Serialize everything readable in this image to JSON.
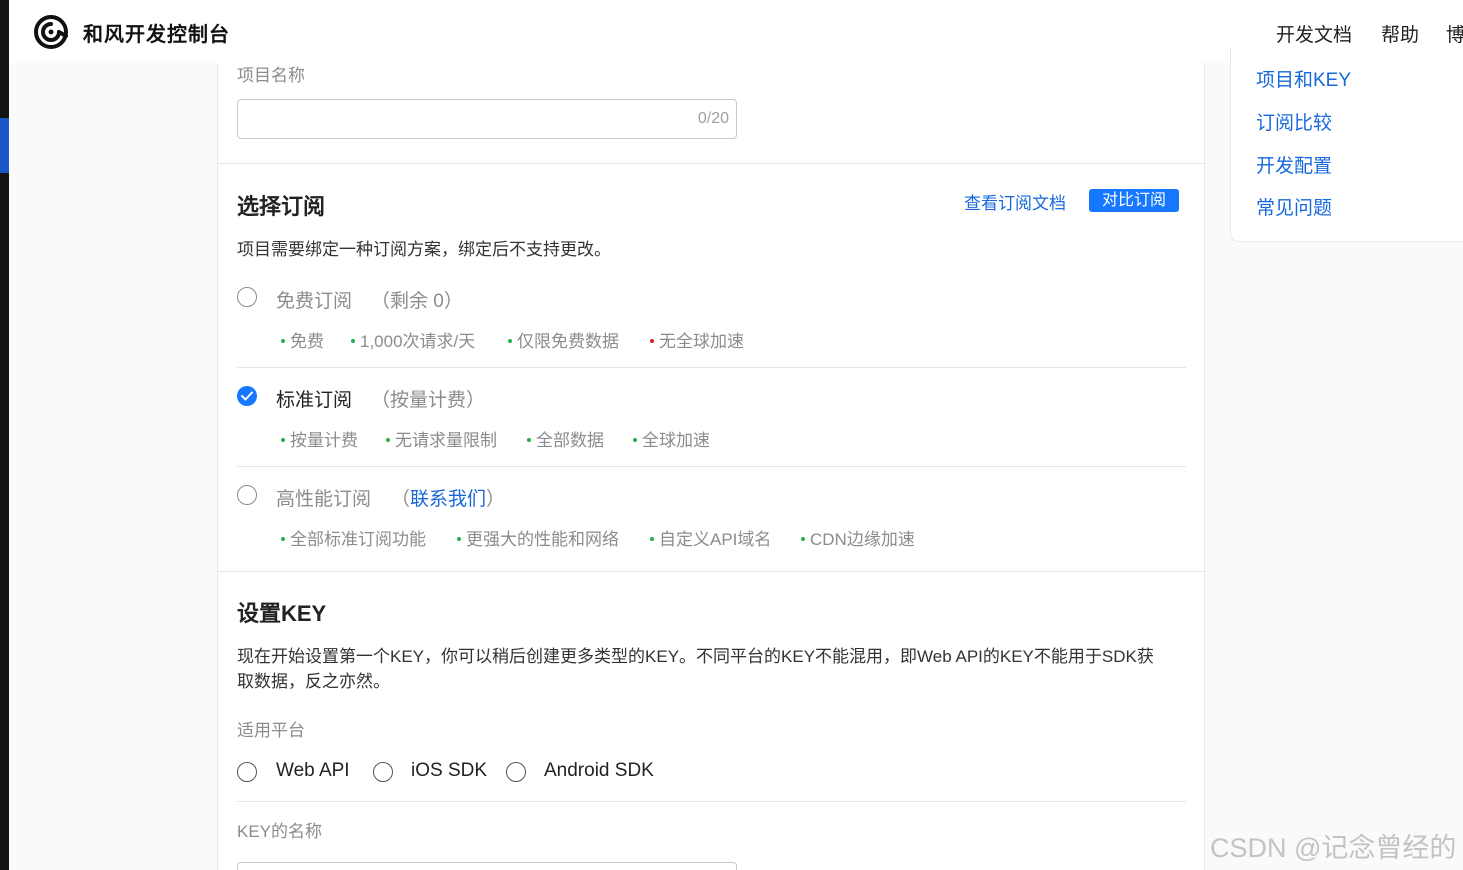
{
  "header": {
    "brand": "和风开发控制台",
    "nav": [
      "开发文档",
      "帮助",
      "博"
    ]
  },
  "toc": {
    "items": [
      "项目和KEY",
      "订阅比较",
      "开发配置",
      "常见问题"
    ]
  },
  "project": {
    "name_label": "项目名称",
    "name_value": "",
    "name_counter": "0/20"
  },
  "subscription": {
    "title": "选择订阅",
    "doc_link": "查看订阅文档",
    "compare_button": "对比订阅",
    "description": "项目需要绑定一种订阅方案，绑定后不支持更改。",
    "options": [
      {
        "name": "免费订阅",
        "tag_open": "（",
        "tag": "剩余 0",
        "tag_close": "）",
        "state": "disabled",
        "features": [
          "免费",
          "1,000次请求/天",
          "仅限免费数据",
          "无全球加速"
        ],
        "feature_dot_colors": [
          "#22b14c",
          "#22b14c",
          "#22b14c",
          "#e02020"
        ]
      },
      {
        "name": "标准订阅",
        "tag_open": "（",
        "tag": "按量计费",
        "tag_close": "）",
        "state": "selected",
        "features": [
          "按量计费",
          "无请求量限制",
          "全部数据",
          "全球加速"
        ],
        "feature_dot_colors": [
          "#22b14c",
          "#22b14c",
          "#22b14c",
          "#22b14c"
        ]
      },
      {
        "name": "高性能订阅",
        "tag_open": "（",
        "tag": "联系我们",
        "tag_close": "）",
        "state": "unselected",
        "features": [
          "全部标准订阅功能",
          "更强大的性能和网络",
          "自定义API域名",
          "CDN边缘加速"
        ],
        "feature_dot_colors": [
          "#22b14c",
          "#22b14c",
          "#22b14c",
          "#22b14c"
        ]
      }
    ]
  },
  "key": {
    "title": "设置KEY",
    "description_line1": "现在开始设置第一个KEY，你可以稍后创建更多类型的KEY。不同平台的KEY不能混用，即Web API的KEY不能用于SDK获",
    "description_line2": "取数据，反之亦然。",
    "platform_label": "适用平台",
    "platforms": [
      "Web API",
      "iOS SDK",
      "Android SDK"
    ],
    "name_label": "KEY的名称"
  },
  "watermark": "CSDN @记念曾经的",
  "colors": {
    "accent": "#1677ff",
    "link": "#1668dc",
    "feature_ok": "#22b14c",
    "feature_no": "#e02020"
  }
}
